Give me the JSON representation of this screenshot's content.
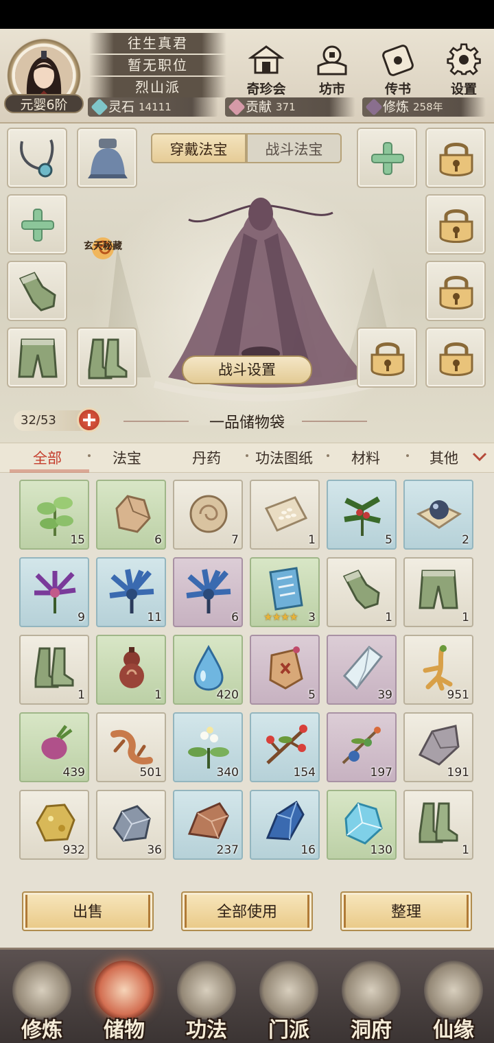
{
  "player": {
    "name": "往生真君",
    "position": "暂无职位",
    "sect": "烈山派",
    "realm": "元婴6阶"
  },
  "top_nav": [
    {
      "label": "奇珍会",
      "icon": "treasure-pavilion-icon"
    },
    {
      "label": "坊市",
      "icon": "market-icon"
    },
    {
      "label": "传书",
      "icon": "letter-scroll-icon"
    },
    {
      "label": "设置",
      "icon": "gear-icon"
    }
  ],
  "resources": {
    "spirit_stone_label": "灵石",
    "spirit_stone_value": "14111",
    "contribution_label": "贡献",
    "contribution_value": "371",
    "cultivation_label": "修炼",
    "cultivation_value": "258年"
  },
  "equip": {
    "tab_wear": "穿戴法宝",
    "tab_battle": "战斗法宝",
    "secret_label": "玄天秘藏",
    "battle_settings": "战斗设置"
  },
  "bag": {
    "count": "32/53",
    "title": "一品储物袋"
  },
  "categories": [
    "全部",
    "法宝",
    "丹药",
    "功法图纸",
    "材料",
    "其他"
  ],
  "items": [
    {
      "icon": "herb-leaf-icon",
      "quality": "green",
      "count": "15"
    },
    {
      "icon": "ore-chunk-icon",
      "quality": "green",
      "count": "6"
    },
    {
      "icon": "spirit-pearl-icon",
      "quality": "white",
      "count": "7"
    },
    {
      "icon": "rice-seeds-icon",
      "quality": "white",
      "count": "1"
    },
    {
      "icon": "berry-herb-icon",
      "quality": "blue",
      "count": "5"
    },
    {
      "icon": "orb-cloth-icon",
      "quality": "blue",
      "count": "2"
    },
    {
      "icon": "purple-flower-icon",
      "quality": "blue",
      "count": "9"
    },
    {
      "icon": "blue-flower-icon",
      "quality": "blue",
      "count": "11"
    },
    {
      "icon": "blue-flower-icon",
      "quality": "purple",
      "count": "6"
    },
    {
      "icon": "skill-scroll-icon",
      "quality": "green",
      "count": "3",
      "stars": "★★★★"
    },
    {
      "icon": "gloves-icon",
      "quality": "white",
      "count": "1"
    },
    {
      "icon": "pants-icon",
      "quality": "white",
      "count": "1"
    },
    {
      "icon": "boots-icon",
      "quality": "white",
      "count": "1"
    },
    {
      "icon": "gourd-icon",
      "quality": "green",
      "count": "1"
    },
    {
      "icon": "water-drop-icon",
      "quality": "green",
      "count": "420"
    },
    {
      "icon": "talisman-icon",
      "quality": "purple",
      "count": "5"
    },
    {
      "icon": "crystal-shard-icon",
      "quality": "purple",
      "count": "39"
    },
    {
      "icon": "ginseng-root-icon",
      "quality": "white",
      "count": "951"
    },
    {
      "icon": "radish-root-icon",
      "quality": "green",
      "count": "439"
    },
    {
      "icon": "twisted-root-icon",
      "quality": "white",
      "count": "501"
    },
    {
      "icon": "white-flower-herb-icon",
      "quality": "blue",
      "count": "340"
    },
    {
      "icon": "red-bud-branch-icon",
      "quality": "blue",
      "count": "154"
    },
    {
      "icon": "fruit-branch-icon",
      "quality": "purple",
      "count": "197"
    },
    {
      "icon": "grey-stone-icon",
      "quality": "white",
      "count": "191"
    },
    {
      "icon": "gold-ore-icon",
      "quality": "white",
      "count": "932"
    },
    {
      "icon": "silver-ore-icon",
      "quality": "white",
      "count": "36"
    },
    {
      "icon": "red-ore-icon",
      "quality": "blue",
      "count": "237"
    },
    {
      "icon": "blue-ore-icon",
      "quality": "blue",
      "count": "16"
    },
    {
      "icon": "ice-crystal-icon",
      "quality": "green",
      "count": "130"
    },
    {
      "icon": "boots-icon",
      "quality": "white",
      "count": "1"
    }
  ],
  "actions": {
    "sell": "出售",
    "use_all": "全部使用",
    "sort": "整理"
  },
  "bottom_nav": [
    {
      "label": "修炼",
      "icon": "meditation-icon"
    },
    {
      "label": "储物",
      "icon": "storage-bag-icon",
      "active": true
    },
    {
      "label": "功法",
      "icon": "scroll-book-icon"
    },
    {
      "label": "门派",
      "icon": "sect-gate-icon"
    },
    {
      "label": "洞府",
      "icon": "cave-dwelling-icon"
    },
    {
      "label": "仙缘",
      "icon": "immortal-fate-icon"
    }
  ],
  "colors": {
    "accent_red": "#c43c2b",
    "quality_white": "#e9e4d6",
    "quality_green": "#c7d9b3",
    "quality_blue": "#c2dbe1",
    "quality_purple": "#d0bfcc"
  }
}
